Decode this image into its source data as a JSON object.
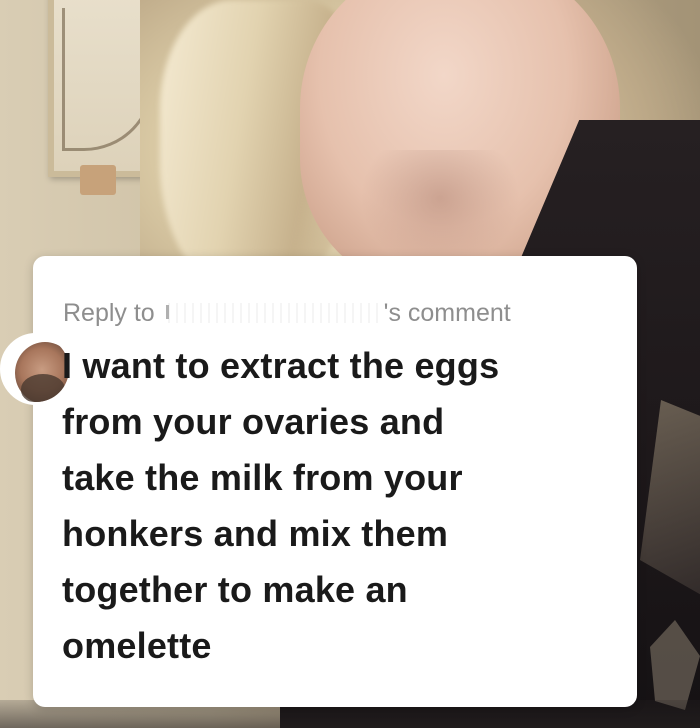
{
  "reply": {
    "prefix": "Reply to",
    "suffix": "'s comment",
    "comment_text": "I want to extract the eggs\nfrom your ovaries and\ntake the milk from your\nhonkers and mix them\ntogether to make an\nomelette"
  },
  "avatar_icon": "commenter-avatar",
  "colors": {
    "card_background": "#ffffff",
    "header_text": "#8e8e8e",
    "comment_text": "#1a1a1a"
  }
}
